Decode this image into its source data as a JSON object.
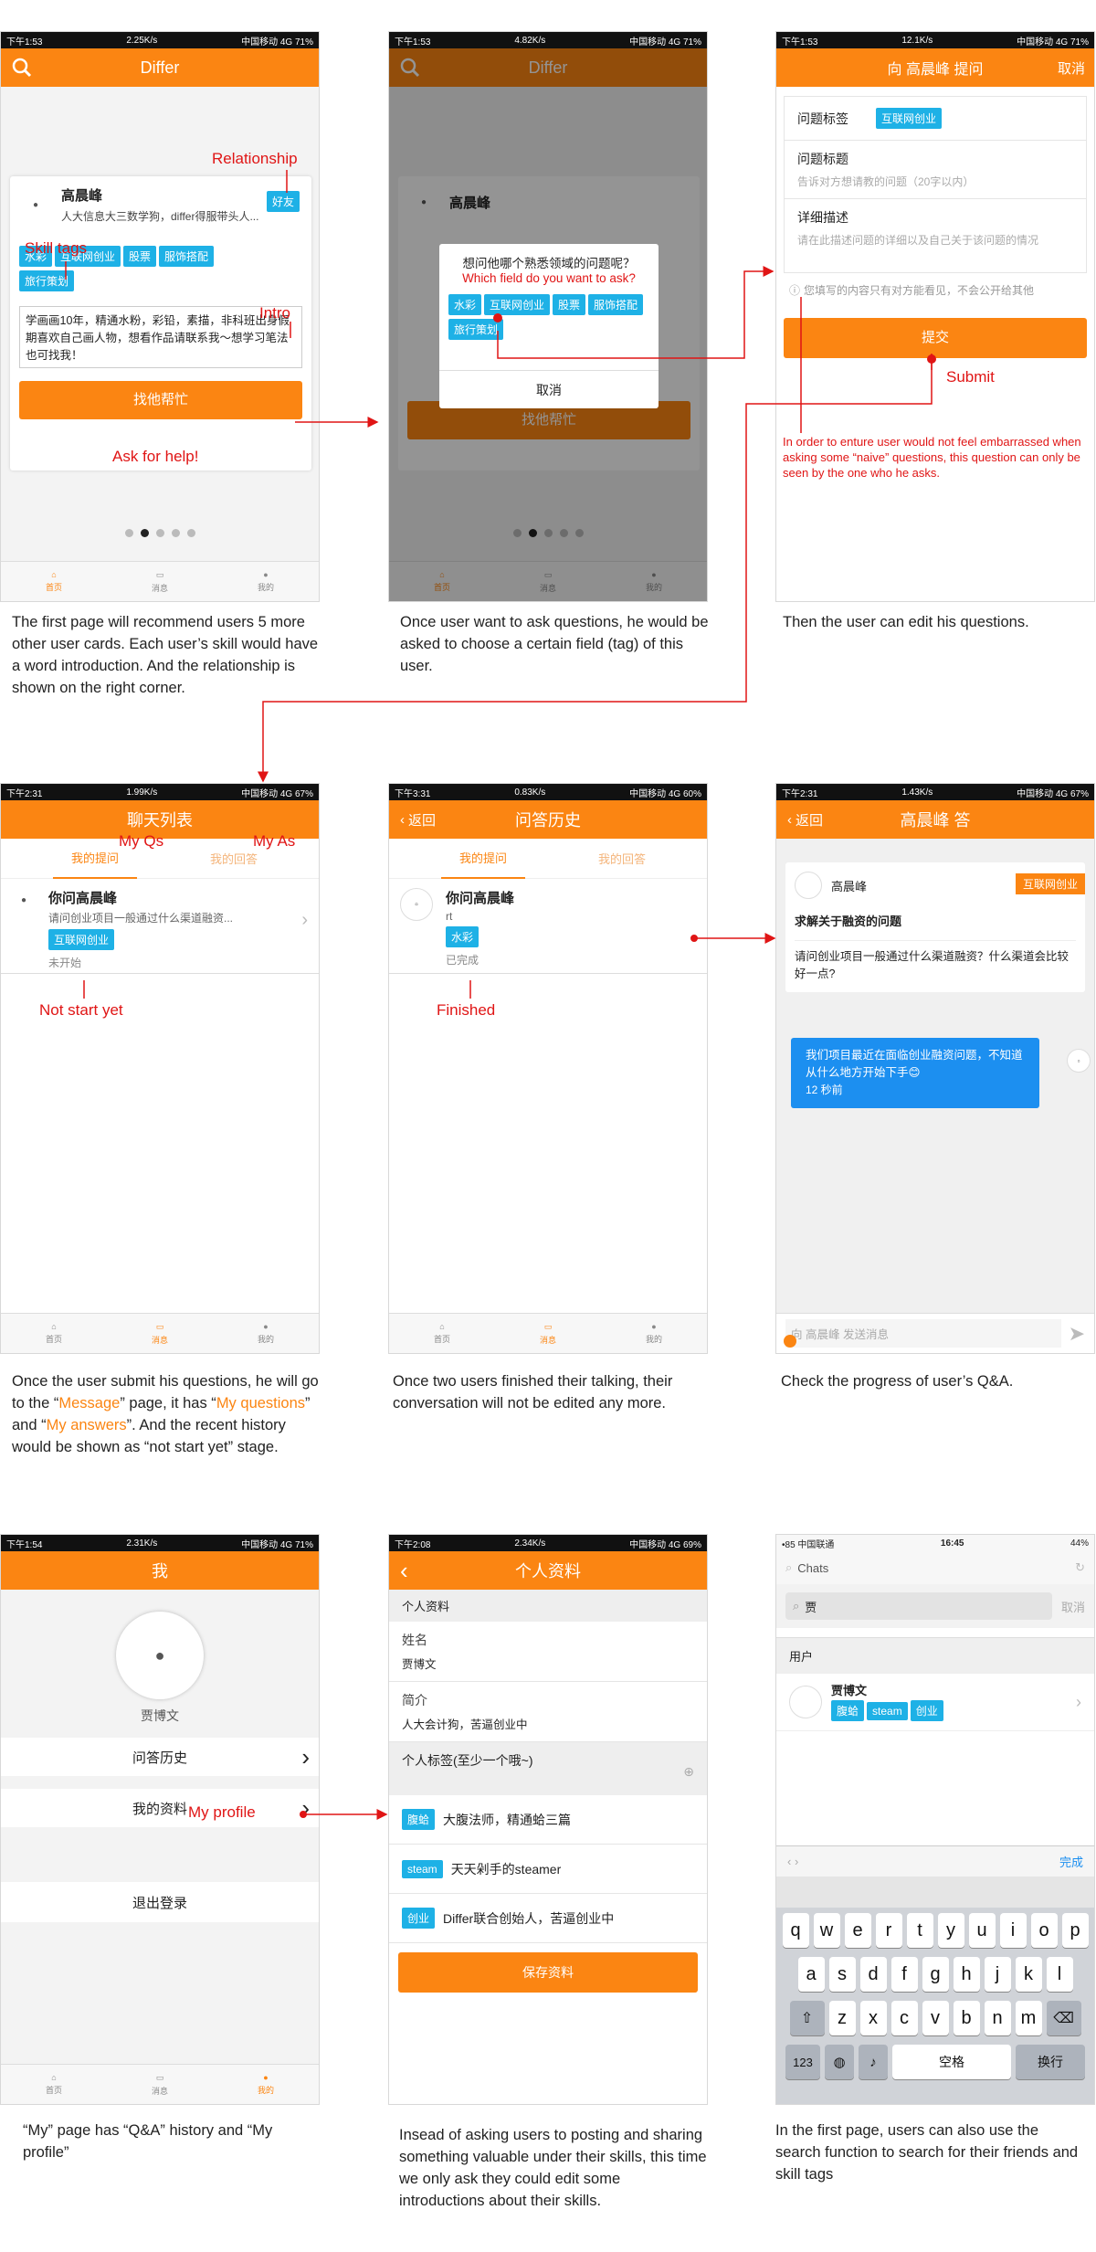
{
  "s1": {
    "status_left": "下午1:53",
    "status_speed": "2.25K/s",
    "status_right": "中国移动 4G 71%",
    "title": "Differ",
    "user_name": "高晨峰",
    "user_desc": "人大信息大三数学狗，differ得服带头人...",
    "relation": "好友",
    "tags": [
      "水彩",
      "互联网创业",
      "股票",
      "服饰搭配",
      "旅行策划"
    ],
    "intro": "学画画10年，精通水粉，彩铅，素描，非科班出身假期喜欢自己画人物，想看作品请联系我～想学习笔法也可找我！",
    "help_btn": "找他帮忙"
  },
  "tabs": {
    "home": "首页",
    "msg": "消息",
    "me": "我的"
  },
  "s2": {
    "status_left": "下午1:53",
    "status_speed": "4.82K/s",
    "status_right": "中国移动 4G 71%",
    "dialog_q": "想问他哪个熟悉领域的问题呢？",
    "dialog_en": "Which field do you want to ask?",
    "tags": [
      "水彩",
      "互联网创业",
      "股票",
      "服饰搭配",
      "旅行策划"
    ],
    "cancel": "取消"
  },
  "s3": {
    "status_left": "下午1:53",
    "status_speed": "12.1K/s",
    "status_right": "中国移动 4G 71%",
    "title": "向 高晨峰 提问",
    "cancel": "取消",
    "tag_label": "问题标签",
    "tag_value": "互联网创业",
    "q_title": "问题标题",
    "q_title_ph": "告诉对方想请教的问题（20字以内）",
    "q_detail": "详细描述",
    "q_detail_ph": "请在此描述问题的详细以及自己关于该问题的情况",
    "notice": "您填写的内容只有对方能看见，不会公开给其他",
    "submit": "提交"
  },
  "s4": {
    "status_left": "下午2:31",
    "status_speed": "1.99K/s",
    "status_right": "中国移动 4G 67%",
    "title": "聊天列表",
    "tab_q": "我的提问",
    "tab_a": "我的回答",
    "chat_title": "你问高晨峰",
    "chat_desc": "请问创业项目一般通过什么渠道融资...",
    "chat_tag": "互联网创业",
    "chat_status": "未开始"
  },
  "s5": {
    "status_left": "下午3:31",
    "status_speed": "0.83K/s",
    "status_right": "中国移动 4G 60%",
    "back": "返回",
    "title": "问答历史",
    "tab_q": "我的提问",
    "tab_a": "我的回答",
    "chat_title": "你问高晨峰",
    "chat_desc": "rt",
    "chat_tag": "水彩",
    "chat_status": "已完成"
  },
  "s6": {
    "status_left": "下午2:31",
    "status_speed": "1.43K/s",
    "status_right": "中国移动 4G 67%",
    "back": "返回",
    "title": "高晨峰 答",
    "name": "高晨峰",
    "tag": "互联网创业",
    "q_head": "求解关于融资的问题",
    "q_body": "请问创业项目一般通过什么渠道融资？什么渠道会比较好一点?",
    "bubble": "我们项目最近在面临创业融资问题，不知道从什么地方开始下手😊",
    "bubble_time": "12 秒前",
    "input_ph": "向 高晨峰 发送消息"
  },
  "s7": {
    "status_left": "下午1:54",
    "status_speed": "2.31K/s",
    "status_right": "中国移动 4G 71%",
    "title": "我",
    "name": "贾博文",
    "history": "问答历史",
    "profile": "我的资料",
    "logout": "退出登录"
  },
  "s8": {
    "status_left": "下午2:08",
    "status_speed": "2.34K/s",
    "status_right": "中国移动 4G 69%",
    "title": "个人资料",
    "section": "个人资料",
    "name_label": "姓名",
    "name_value": "贾博文",
    "intro_label": "简介",
    "intro_value": "人大会计狗，苦逼创业中",
    "tags_label": "个人标签(至少一个哦~)",
    "tags": [
      {
        "tag": "腹蛤",
        "text": "大腹法师，精通蛤三篇"
      },
      {
        "tag": "steam",
        "text": "天天剁手的steamer"
      },
      {
        "tag": "创业",
        "text": "Differ联合创始人，苦逼创业中"
      }
    ],
    "save": "保存资料"
  },
  "s9": {
    "status_left": "•85 中国联通",
    "status_time": "16:45",
    "status_right": "44%",
    "search_ph": "Chats",
    "search_value": "贾",
    "cancel": "取消",
    "section": "用户",
    "name": "贾博文",
    "tags": [
      "腹蛤",
      "steam",
      "创业"
    ],
    "done": "完成",
    "row1": [
      "q",
      "w",
      "e",
      "r",
      "t",
      "y",
      "u",
      "i",
      "o",
      "p"
    ],
    "row2": [
      "a",
      "s",
      "d",
      "f",
      "g",
      "h",
      "j",
      "k",
      "l"
    ],
    "row3": [
      "z",
      "x",
      "c",
      "v",
      "b",
      "n",
      "m"
    ],
    "k123": "123",
    "space": "空格",
    "enter": "换行"
  },
  "ann": {
    "relationship": "Relationship",
    "skill_tags": "Skill tags",
    "intro": "Intro",
    "ask": "Ask for help!",
    "submit": "Submit",
    "embarrass": "In order to enture user would not feel embarrassed when asking some “naive” questions, this question can only be seen by the one who he asks.",
    "my_qs": "My Qs",
    "my_as": "My As",
    "not_start": "Not start yet",
    "finished": "Finished",
    "my_profile": "My profile"
  },
  "cap": {
    "c1": "The first page will recommend users 5 more other user cards. Each user’s skill would have a word introduction. And the relationship is shown on the right corner.",
    "c2": "Once user want to ask questions, he would be asked to choose a certain field (tag) of this user.",
    "c3": "Then the user can edit his questions.",
    "c4a": "Once the user submit his questions, he will go to the “",
    "c4b": "Message",
    "c4c": "” page, it has “",
    "c4d": "My questions",
    "c4e": "” and “",
    "c4f": "My answers",
    "c4g": "”. And the recent history would be shown as “not start yet” stage.",
    "c5": "Once two users finished their talking, their conversation will not be edited any more.",
    "c6": "Check the progress of user’s Q&A.",
    "c7": "“My” page has “Q&A” history and “My profile”",
    "c8": "Insead of asking users to posting and sharing something valuable under their skills, this time we only ask they could edit some introductions about their skills.",
    "c9": "In the first page, users can also use the search function to search for their friends and skill tags"
  }
}
